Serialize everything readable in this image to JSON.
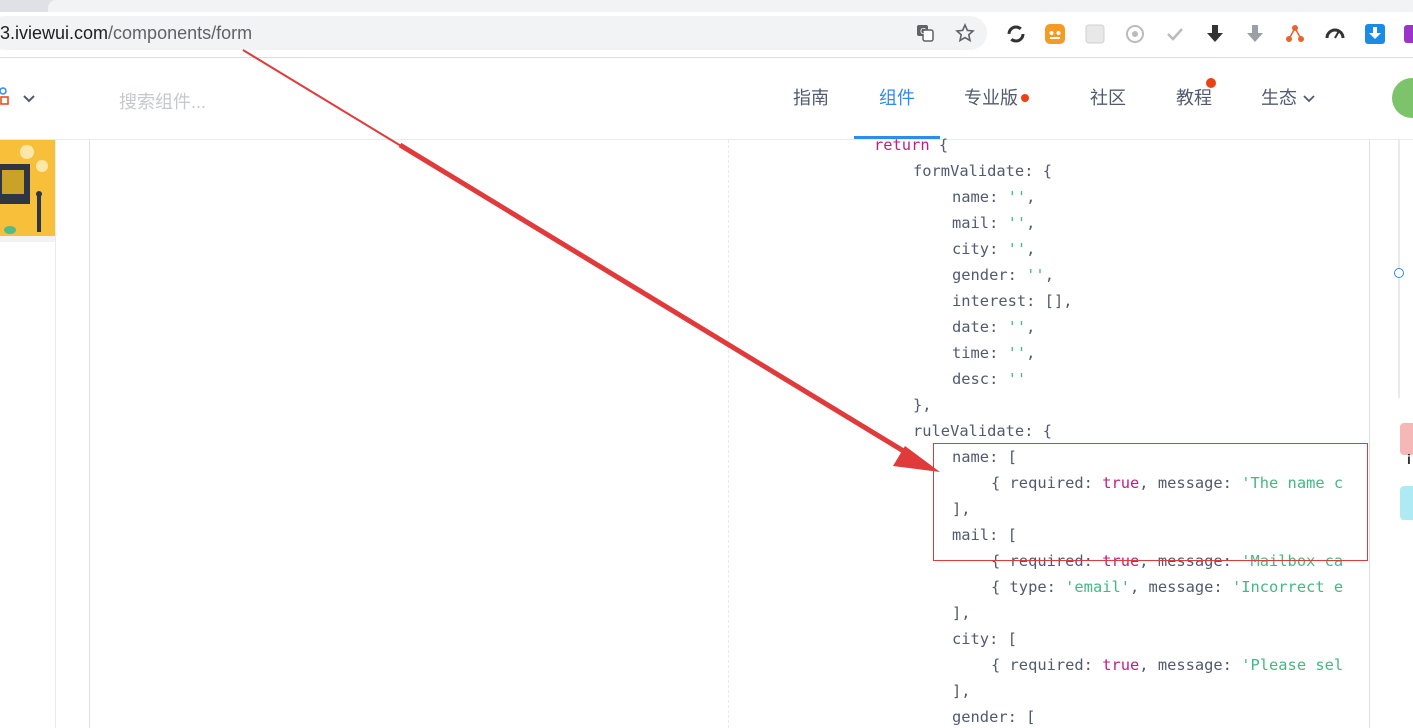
{
  "browser": {
    "url_host": "3.iviewui.com",
    "url_path": "/components/form",
    "icons": [
      "translate-icon",
      "star-icon",
      "circle-arrows-icon",
      "face-icon",
      "grid-icon",
      "target-icon",
      "check-icon",
      "download-icon",
      "download-gray-icon",
      "network-icon",
      "gauge-icon",
      "download-blue-icon",
      "bookmark-icon"
    ]
  },
  "header": {
    "search_placeholder": "搜索组件...",
    "nav": [
      {
        "label": "指南",
        "active": false
      },
      {
        "label": "组件",
        "active": true
      },
      {
        "label": "专业版",
        "active": false
      },
      {
        "label": "社区",
        "active": false
      },
      {
        "label": "教程",
        "active": false
      },
      {
        "label": "生态",
        "active": false
      }
    ],
    "accent_color": "#2d8cf0",
    "badge_color": "#ed4014"
  },
  "code": {
    "lines": [
      {
        "indent": 0,
        "tokens": [
          {
            "t": "return",
            "c": "ret"
          },
          {
            "t": " {",
            "c": "p"
          }
        ]
      },
      {
        "indent": 1,
        "tokens": [
          {
            "t": "formValidate",
            "c": "key"
          },
          {
            "t": ": {",
            "c": "p"
          }
        ]
      },
      {
        "indent": 2,
        "tokens": [
          {
            "t": "name",
            "c": "key"
          },
          {
            "t": ": ",
            "c": "p"
          },
          {
            "t": "''",
            "c": "str"
          },
          {
            "t": ",",
            "c": "p"
          }
        ]
      },
      {
        "indent": 2,
        "tokens": [
          {
            "t": "mail",
            "c": "key"
          },
          {
            "t": ": ",
            "c": "p"
          },
          {
            "t": "''",
            "c": "str"
          },
          {
            "t": ",",
            "c": "p"
          }
        ]
      },
      {
        "indent": 2,
        "tokens": [
          {
            "t": "city",
            "c": "key"
          },
          {
            "t": ": ",
            "c": "p"
          },
          {
            "t": "''",
            "c": "str"
          },
          {
            "t": ",",
            "c": "p"
          }
        ]
      },
      {
        "indent": 2,
        "tokens": [
          {
            "t": "gender",
            "c": "key"
          },
          {
            "t": ": ",
            "c": "p"
          },
          {
            "t": "''",
            "c": "str"
          },
          {
            "t": ",",
            "c": "p"
          }
        ]
      },
      {
        "indent": 2,
        "tokens": [
          {
            "t": "interest",
            "c": "key"
          },
          {
            "t": ": [],",
            "c": "p"
          }
        ]
      },
      {
        "indent": 2,
        "tokens": [
          {
            "t": "date",
            "c": "key"
          },
          {
            "t": ": ",
            "c": "p"
          },
          {
            "t": "''",
            "c": "str"
          },
          {
            "t": ",",
            "c": "p"
          }
        ]
      },
      {
        "indent": 2,
        "tokens": [
          {
            "t": "time",
            "c": "key"
          },
          {
            "t": ": ",
            "c": "p"
          },
          {
            "t": "''",
            "c": "str"
          },
          {
            "t": ",",
            "c": "p"
          }
        ]
      },
      {
        "indent": 2,
        "tokens": [
          {
            "t": "desc",
            "c": "key"
          },
          {
            "t": ": ",
            "c": "p"
          },
          {
            "t": "''",
            "c": "str"
          }
        ]
      },
      {
        "indent": 1,
        "tokens": [
          {
            "t": "},",
            "c": "p"
          }
        ]
      },
      {
        "indent": 1,
        "tokens": [
          {
            "t": "ruleValidate",
            "c": "key"
          },
          {
            "t": ": {",
            "c": "p"
          }
        ]
      },
      {
        "indent": 2,
        "tokens": [
          {
            "t": "name",
            "c": "key"
          },
          {
            "t": ": [",
            "c": "p"
          }
        ]
      },
      {
        "indent": 3,
        "tokens": [
          {
            "t": "{ required: ",
            "c": "p"
          },
          {
            "t": "true",
            "c": "kw"
          },
          {
            "t": ", message: ",
            "c": "p"
          },
          {
            "t": "'The name c",
            "c": "str"
          }
        ]
      },
      {
        "indent": 2,
        "tokens": [
          {
            "t": "],",
            "c": "p"
          }
        ]
      },
      {
        "indent": 2,
        "tokens": [
          {
            "t": "mail",
            "c": "key"
          },
          {
            "t": ": [",
            "c": "p"
          }
        ]
      },
      {
        "indent": 3,
        "tokens": [
          {
            "t": "{ required: ",
            "c": "p"
          },
          {
            "t": "true",
            "c": "kw"
          },
          {
            "t": ", message: ",
            "c": "p"
          },
          {
            "t": "'Mailbox ca",
            "c": "str"
          }
        ]
      },
      {
        "indent": 3,
        "tokens": [
          {
            "t": "{ type: ",
            "c": "p"
          },
          {
            "t": "'email'",
            "c": "str"
          },
          {
            "t": ", message: ",
            "c": "p"
          },
          {
            "t": "'Incorrect e",
            "c": "str"
          }
        ]
      },
      {
        "indent": 2,
        "tokens": [
          {
            "t": "],",
            "c": "p"
          }
        ]
      },
      {
        "indent": 2,
        "tokens": [
          {
            "t": "city",
            "c": "key"
          },
          {
            "t": ": [",
            "c": "p"
          }
        ]
      },
      {
        "indent": 3,
        "tokens": [
          {
            "t": "{ required: ",
            "c": "p"
          },
          {
            "t": "true",
            "c": "kw"
          },
          {
            "t": ", message: ",
            "c": "p"
          },
          {
            "t": "'Please sel",
            "c": "str"
          }
        ]
      },
      {
        "indent": 2,
        "tokens": [
          {
            "t": "],",
            "c": "p"
          }
        ]
      },
      {
        "indent": 2,
        "tokens": [
          {
            "t": "gender",
            "c": "key"
          },
          {
            "t": ": [",
            "c": "p"
          }
        ]
      }
    ]
  },
  "annotation": {
    "color": "#e03a3a"
  }
}
